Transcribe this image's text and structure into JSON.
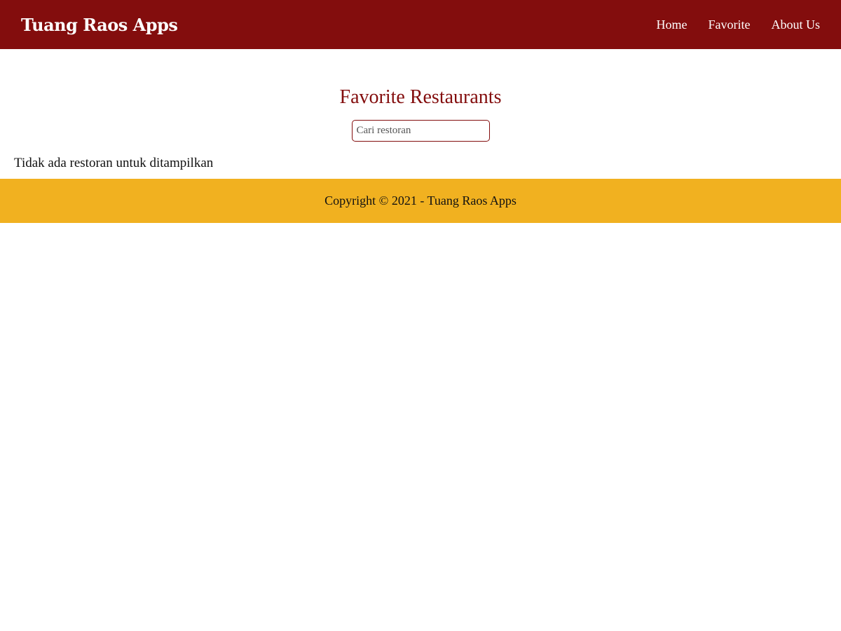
{
  "header": {
    "brand": "Tuang Raos Apps",
    "nav": [
      {
        "label": "Home"
      },
      {
        "label": "Favorite"
      },
      {
        "label": "About Us"
      }
    ]
  },
  "main": {
    "title": "Favorite Restaurants",
    "search": {
      "placeholder": "Cari restoran",
      "value": ""
    },
    "empty_message": "Tidak ada restoran untuk ditampilkan"
  },
  "footer": {
    "copyright": "Copyright © 2021 - Tuang Raos Apps"
  },
  "colors": {
    "header_bg": "#830d0d",
    "accent": "#830d0d",
    "footer_bg": "#f1b120"
  }
}
